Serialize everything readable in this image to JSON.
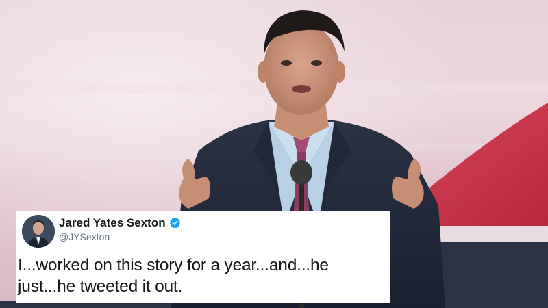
{
  "tweet": {
    "author_name": "Jared Yates Sexton",
    "author_handle": "@JYSexton",
    "verified": true,
    "text": "I...worked on this story for a year...and...he just...he tweeted it out.",
    "verified_color": "#1da1f2"
  },
  "photo": {
    "subject": "man speaking at podium",
    "background_colors": [
      "#e8cdd6",
      "#c8344a",
      "#1b2233"
    ]
  }
}
